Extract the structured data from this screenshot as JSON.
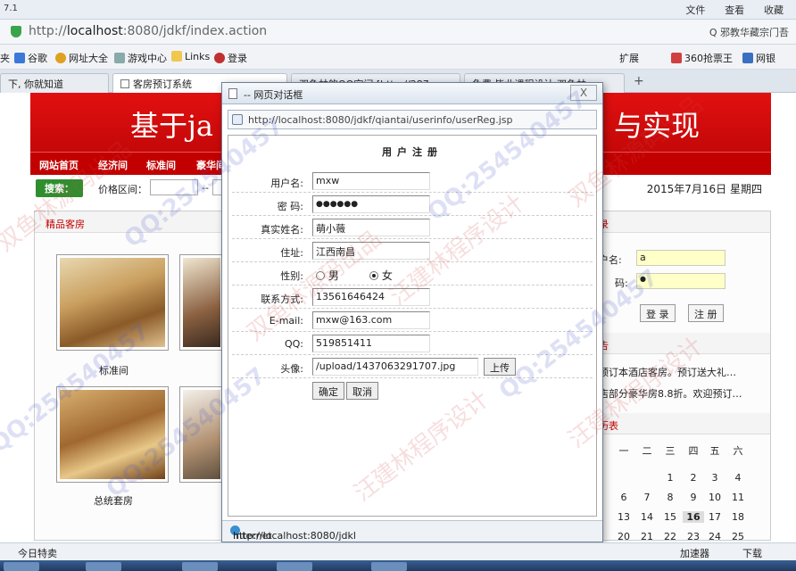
{
  "window": {
    "version": "7.1",
    "menu": [
      "文件",
      "查看",
      "收藏"
    ]
  },
  "address_bar": {
    "url_prefix": "http://",
    "url_host": "localhost",
    "url_rest": ":8080/jdkf/index.action",
    "search_text": "Q 邪教华藏宗门吾"
  },
  "favorites": [
    "谷歌",
    "网址大全",
    "游戏中心",
    "Links",
    "登录"
  ],
  "favorites_prefix": "夹",
  "favorites_right": [
    "扩展",
    "360抢票王",
    "网银"
  ],
  "tabs": [
    {
      "label": "下, 你就知道"
    },
    {
      "label": "客房预订系统"
    },
    {
      "label": "双鱼林的QQ空间 [http://287..."
    },
    {
      "label": "免费 毕业课程设计 双鱼林..."
    }
  ],
  "site": {
    "banner_left": "基于ja",
    "banner_right": "与实现",
    "nav": [
      "网站首页",
      "经济间",
      "标准间",
      "豪华间"
    ],
    "search_label": "搜索：",
    "price_label": "价格区间：",
    "price_sep": "--",
    "date": "2015年7月16日 星期四",
    "featured_title": "精品客房",
    "rooms": [
      {
        "label": "标准间"
      },
      {
        "label": ""
      },
      {
        "label": "总统套房"
      },
      {
        "label": "总"
      }
    ],
    "login_title": "录",
    "login_user_label": "户名:",
    "login_user_value": "a",
    "login_pwd_label": "码:",
    "login_pwd_value": "●",
    "login_btn": "登 录",
    "register_btn": "注 册",
    "notice_title": "告",
    "notices": [
      "预订本酒店客房。预订送大礼…",
      "店部分豪华房8.8折。欢迎预订…"
    ],
    "calendar_title": "历表",
    "cal_headers": [
      "一",
      "二",
      "三",
      "四",
      "五",
      "六"
    ],
    "cal_rows": [
      [
        "",
        "",
        "1",
        "2",
        "3",
        "4"
      ],
      [
        "6",
        "7",
        "8",
        "9",
        "10",
        "11"
      ],
      [
        "13",
        "14",
        "15",
        "16",
        "17",
        "18"
      ],
      [
        "20",
        "21",
        "22",
        "23",
        "24",
        "25"
      ]
    ],
    "cal_partial_left": [
      "2",
      "9"
    ]
  },
  "dialog": {
    "title": "-- 网页对话框",
    "close": "X",
    "url": "http://localhost:8080/jdkf/qiantai/userinfo/userReg.jsp",
    "form_title": "用户注册",
    "fields": {
      "username": {
        "label": "用户名:",
        "value": "mxw"
      },
      "password": {
        "label": "密 码:",
        "value": "●●●●●●"
      },
      "realname": {
        "label": "真实姓名:",
        "value": "萌小薇"
      },
      "address": {
        "label": "住址:",
        "value": "江西南昌"
      },
      "gender": {
        "label": "性别:",
        "male": "男",
        "female": "女",
        "selected": "女"
      },
      "phone": {
        "label": "联系方式:",
        "value": "13561646424"
      },
      "email": {
        "label": "E-mail:",
        "value": "mxw@163.com"
      },
      "qq": {
        "label": "QQ:",
        "value": "519851411"
      },
      "avatar": {
        "label": "头像:",
        "value": "/upload/1437063291707.jpg",
        "upload_btn": "上传"
      }
    },
    "submit": "确定",
    "cancel": "取消",
    "status_url": "http://localhost:8080/jdkl",
    "status_zone": "Internet | 保护模式: 禁用"
  },
  "statusbar": {
    "left": "今日特卖",
    "right": [
      "加速器",
      "下载"
    ]
  },
  "watermark": {
    "text1": "双鱼林源码出品",
    "text2": "汪建林程序设计",
    "qq": "QQ:254540457"
  },
  "colors": {
    "banner_red": "#d00a0a",
    "nav_red": "#c20000",
    "accent_green": "#2f8f2f"
  }
}
